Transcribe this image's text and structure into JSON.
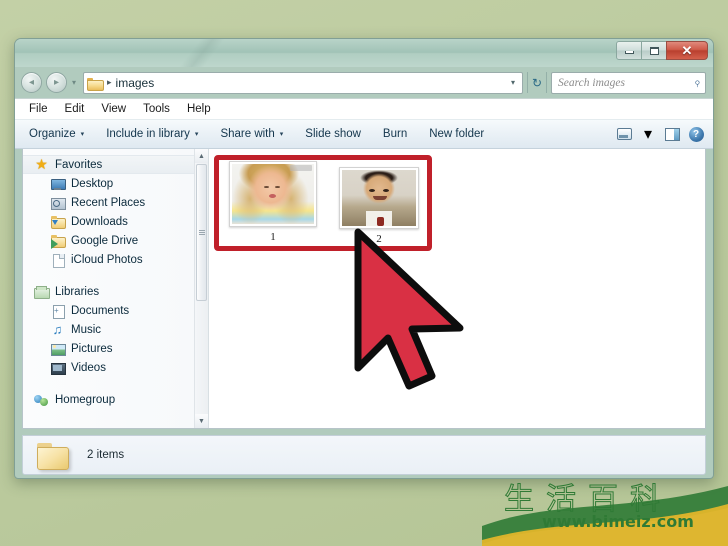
{
  "window": {
    "controls": {
      "minimize": "–",
      "maximize": "□",
      "close": "✕"
    },
    "address": {
      "folder_icon": "folder-icon",
      "separator": "▸",
      "crumb": "images",
      "dropdown_caret": "▾",
      "refresh_icon": "↻",
      "back_icon": "◂",
      "forward_icon": "▸",
      "history_caret": "▾"
    },
    "search": {
      "placeholder": "Search images",
      "icon": "search-icon",
      "glyph": "⌕"
    }
  },
  "menubar": {
    "items": [
      "File",
      "Edit",
      "View",
      "Tools",
      "Help"
    ]
  },
  "commandbar": {
    "items": [
      {
        "label": "Organize",
        "has_caret": true
      },
      {
        "label": "Include in library",
        "has_caret": true
      },
      {
        "label": "Share with",
        "has_caret": true
      },
      {
        "label": "Slide show",
        "has_caret": false
      },
      {
        "label": "Burn",
        "has_caret": false
      },
      {
        "label": "New folder",
        "has_caret": false
      }
    ],
    "caret": "▾",
    "right_icons": [
      {
        "name": "change-view-icon"
      },
      {
        "name": "view-caret-icon",
        "glyph": "▾"
      },
      {
        "name": "preview-pane-icon"
      },
      {
        "name": "help-icon",
        "glyph": "?"
      }
    ]
  },
  "sidebar": {
    "groups": [
      {
        "name": "Favorites",
        "icon": "star-icon",
        "selected": true,
        "children": [
          {
            "label": "Desktop",
            "icon": "desktop-icon"
          },
          {
            "label": "Recent Places",
            "icon": "recent-places-icon"
          },
          {
            "label": "Downloads",
            "icon": "downloads-folder-icon"
          },
          {
            "label": "Google Drive",
            "icon": "google-drive-folder-icon"
          },
          {
            "label": "iCloud Photos",
            "icon": "page-icon"
          }
        ]
      },
      {
        "name": "Libraries",
        "icon": "libraries-icon",
        "selected": false,
        "children": [
          {
            "label": "Documents",
            "icon": "documents-icon"
          },
          {
            "label": "Music",
            "icon": "music-icon"
          },
          {
            "label": "Pictures",
            "icon": "pictures-icon"
          },
          {
            "label": "Videos",
            "icon": "videos-icon"
          }
        ]
      },
      {
        "name": "Homegroup",
        "icon": "homegroup-icon",
        "selected": false,
        "children": []
      }
    ],
    "scrollbar": {
      "up": "▲",
      "down": "▼"
    }
  },
  "content": {
    "selection_color": "#c0202a",
    "items": [
      {
        "caption": "1",
        "alt": "thumbnail-portrait-woman"
      },
      {
        "caption": "2",
        "alt": "thumbnail-portrait-man"
      }
    ]
  },
  "statusbar": {
    "text": "2 items",
    "icon": "folder-icon"
  },
  "cursor": {
    "name": "mouse-pointer",
    "color": "#d93044",
    "outline": "#0d0d0d"
  },
  "watermark": {
    "title": "生活百科",
    "url": "www.bimeiz.com",
    "color": "#2f7a35"
  }
}
